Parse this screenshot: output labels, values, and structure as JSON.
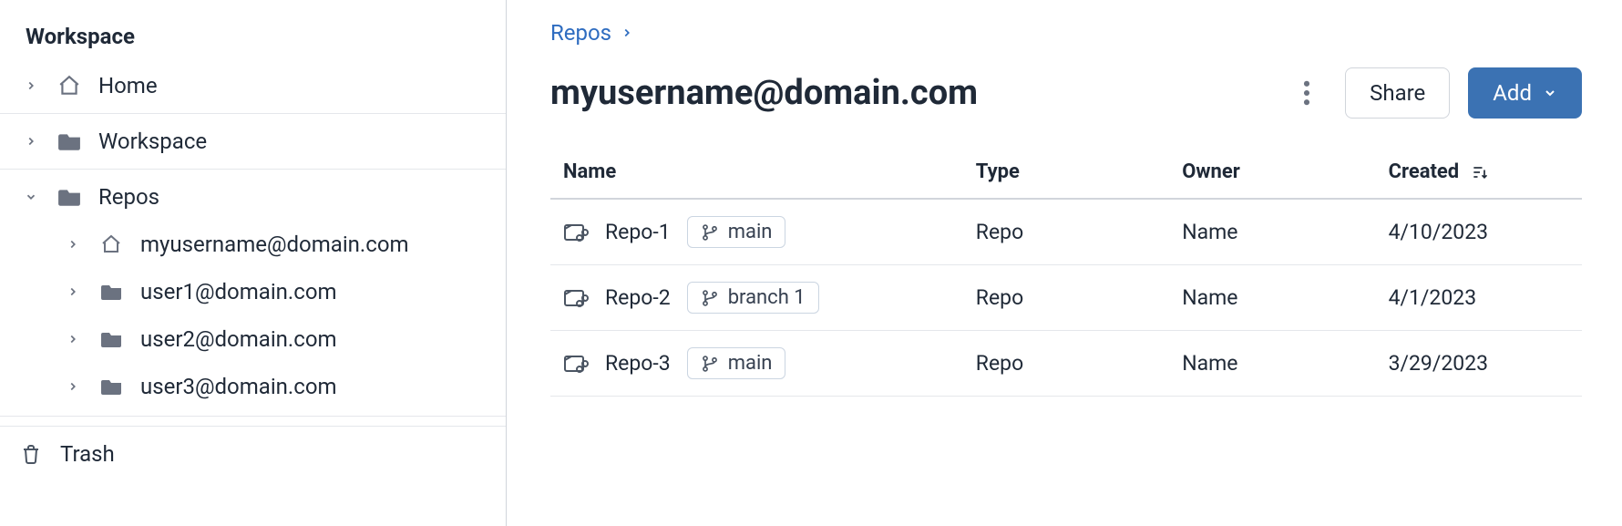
{
  "sidebar": {
    "title": "Workspace",
    "home_label": "Home",
    "workspace_label": "Workspace",
    "repos_label": "Repos",
    "repos_children": [
      {
        "label": "myusername@domain.com",
        "icon": "home"
      },
      {
        "label": "user1@domain.com",
        "icon": "folder"
      },
      {
        "label": "user2@domain.com",
        "icon": "folder"
      },
      {
        "label": "user3@domain.com",
        "icon": "folder"
      }
    ],
    "trash_label": "Trash"
  },
  "breadcrumb": {
    "items": [
      "Repos"
    ]
  },
  "header": {
    "title": "myusername@domain.com",
    "share_label": "Share",
    "add_label": "Add"
  },
  "table": {
    "columns": {
      "name": "Name",
      "type": "Type",
      "owner": "Owner",
      "created": "Created"
    },
    "rows": [
      {
        "name": "Repo-1",
        "branch": "main",
        "type": "Repo",
        "owner": "Name",
        "created": "4/10/2023"
      },
      {
        "name": "Repo-2",
        "branch": "branch 1",
        "type": "Repo",
        "owner": "Name",
        "created": "4/1/2023"
      },
      {
        "name": "Repo-3",
        "branch": "main",
        "type": "Repo",
        "owner": "Name",
        "created": "3/29/2023"
      }
    ]
  },
  "colors": {
    "accent": "#3b72b3",
    "link": "#2e6cc0"
  }
}
